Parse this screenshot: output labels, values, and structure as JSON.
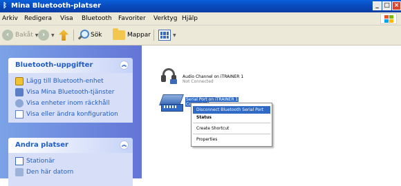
{
  "window": {
    "title": "Mina Bluetooth-platser"
  },
  "menubar": {
    "items": [
      "Arkiv",
      "Redigera",
      "Visa",
      "Bluetooth",
      "Favoriter",
      "Verktyg",
      "Hjälp"
    ]
  },
  "toolbar": {
    "back_label": "Bakåt",
    "search_label": "Sök",
    "folders_label": "Mappar"
  },
  "tasks_panel": {
    "title": "Bluetooth-uppgifter",
    "items": [
      {
        "label": "Lägg till Bluetooth-enhet",
        "icon": "add-device-icon"
      },
      {
        "label": "Visa Mina Bluetooth-tjänster",
        "icon": "bluetooth-services-icon"
      },
      {
        "label": "Visa enheter inom räckhåll",
        "icon": "devices-in-range-icon"
      },
      {
        "label": "Visa eller ändra konfiguration",
        "icon": "configuration-icon"
      }
    ]
  },
  "places_panel": {
    "title": "Andra platser",
    "items": [
      {
        "label": "Stationär",
        "icon": "desktop-icon"
      },
      {
        "label": "Den här datorn",
        "icon": "my-computer-icon"
      }
    ]
  },
  "items": [
    {
      "name": "Audio Channel on iTRAINER 1",
      "status": "Not Connected"
    },
    {
      "name": "Serial Port on iTRAINER 1",
      "status": "Connected"
    }
  ],
  "context_menu": {
    "items": [
      "Disconnect Bluetooth Serial Port",
      "Status",
      "Create Shortcut",
      "Properties"
    ]
  },
  "colors": {
    "titlebar": "#0a5fd8",
    "selection": "#316ac5",
    "task_text": "#215dc6"
  }
}
